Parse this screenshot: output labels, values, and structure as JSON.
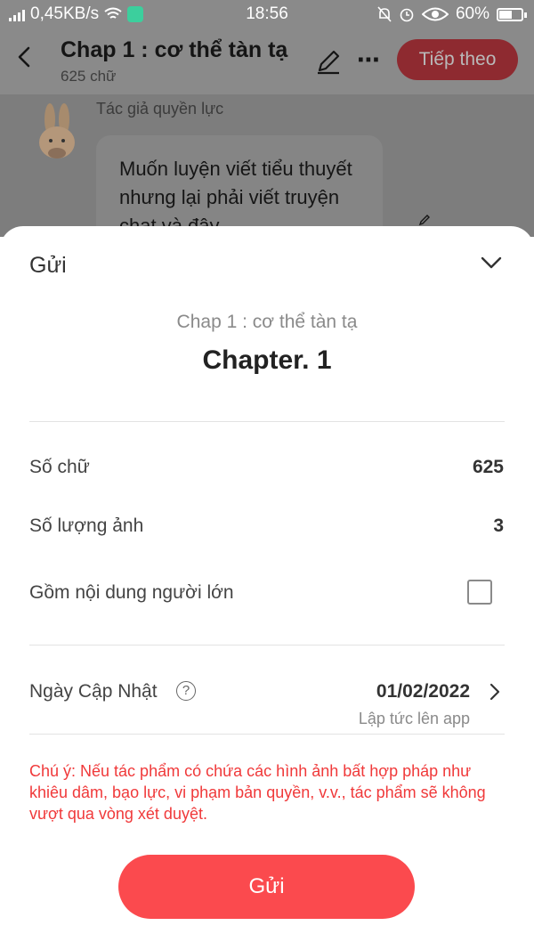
{
  "status_bar": {
    "network_speed": "0,45KB/s",
    "time": "18:56",
    "battery": "60%",
    "battery_level": 0.6
  },
  "header": {
    "title": "Chap 1 : cơ thể tàn tạ",
    "word_count": "625 chữ",
    "follow_label": "Tiếp theo",
    "more_icon": "⋯"
  },
  "background": {
    "author": "Tác giả quyền lực",
    "message": "Muốn luyện viết tiểu thuyết nhưng lại phải viết truyện chat và đây"
  },
  "sheet": {
    "title": "Gửi",
    "chapter_subtitle": "Chap 1 : cơ thể tàn tạ",
    "chapter_name": "Chapter. 1",
    "rows": {
      "word_count_label": "Số chữ",
      "word_count_value": "625",
      "image_count_label": "Số lượng ảnh",
      "image_count_value": "3",
      "adult_label": "Gồm nội dung người lớn",
      "adult_checked": false,
      "update_date_label": "Ngày Cập Nhật",
      "update_date_value": "01/02/2022",
      "update_date_note": "Lập tức lên app",
      "help_glyph": "?"
    },
    "warning": "Chú ý: Nếu tác phẩm có chứa các hình ảnh bất hợp pháp như khiêu dâm, bạo lực, vi phạm bản quyền, v.v., tác phẩm sẽ không vượt qua vòng xét duyệt.",
    "submit_label": "Gửi"
  },
  "colors": {
    "accent": "#fb4a4e",
    "warning": "#f0393a",
    "overlay": "#8a8a8a"
  }
}
